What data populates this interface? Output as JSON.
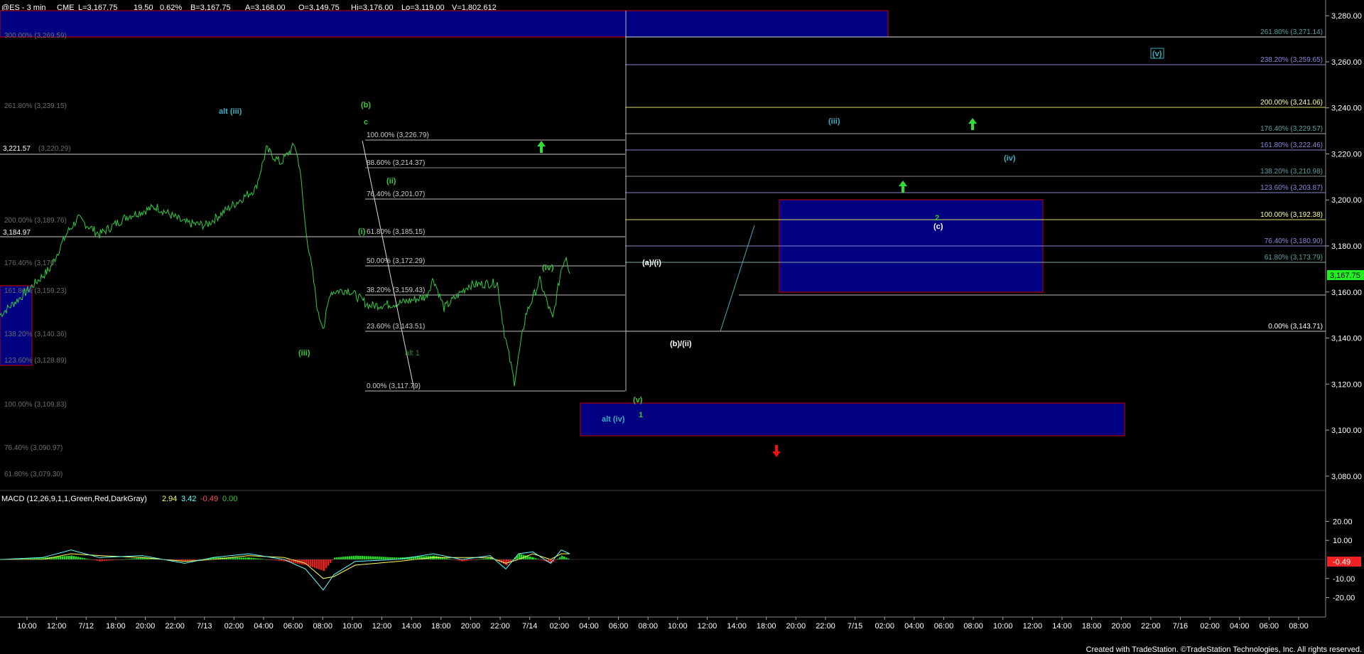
{
  "header": {
    "symbol": "@ES - 3 min",
    "exchange": "CME",
    "last": "L=3,167.75",
    "change": "19.50",
    "change_pct": "0.62%",
    "bid": "B=3,167.75",
    "ask": "A=3,168.00",
    "open": "O=3,149.75",
    "high": "Hi=3,176.00",
    "low": "Lo=3,119.00",
    "volume": "V=1,802,612"
  },
  "price_axis": {
    "ticks": [
      "3,280.00",
      "3,260.00",
      "3,240.00",
      "3,220.00",
      "3,200.00",
      "3,180.00",
      "3,160.00",
      "3,140.00",
      "3,120.00",
      "3,100.00",
      "3,080.00"
    ],
    "current_price": "3,167.75"
  },
  "time_axis": {
    "labels": [
      "10:00",
      "12:00",
      "7/12",
      "18:00",
      "20:00",
      "22:00",
      "7/13",
      "02:00",
      "04:00",
      "06:00",
      "08:00",
      "10:00",
      "12:00",
      "14:00",
      "18:00",
      "20:00",
      "22:00",
      "7/14",
      "02:00",
      "04:00",
      "06:00",
      "08:00",
      "10:00",
      "12:00",
      "14:00",
      "18:00",
      "20:00",
      "22:00",
      "7/15",
      "02:00",
      "04:00",
      "06:00",
      "08:00",
      "10:00",
      "12:00",
      "14:00",
      "18:00",
      "20:00",
      "22:00",
      "7/16",
      "02:00",
      "04:00",
      "06:00",
      "08:00"
    ]
  },
  "left_fib_labels": [
    "300.00% (3,269.59)",
    "261.80% (3,239.15)",
    "3,221.57",
    "(3,220.29)",
    "200.00% (3,189.76)",
    "3,184.97",
    "176.40% (3,170.",
    "161.80% (3,159.23)",
    "138.20% (3,140.36)",
    "123.60% (3,128.89)",
    "100.00% (3,109.83)",
    "76.40% (3,090.97)",
    "61.80% (3,079.30)"
  ],
  "middle_fib_labels": [
    "100.00% (3,226.79)",
    "88.60% (3,214.37)",
    "76.40% (3,201.07)",
    "61.80% (3,185.15)",
    "50.00% (3,172.29)",
    "38.20% (3,159.43)",
    "23.60% (3,143.51)",
    "0.00% (3,117.79)"
  ],
  "right_fib_labels": [
    "261.80% (3,271.14)",
    "238.20% (3,259.65)",
    "200.00% (3,241.06)",
    "176.40% (3,229.57)",
    "161.80% (3,222.46)",
    "138.20% (3,210.98)",
    "123.60% (3,203.87)",
    "100.00% (3,192.38)",
    "76.40% (3,180.90)",
    "61.80% (3,173.79)",
    "0.00% (3,143.71)"
  ],
  "wave_labels": [
    "alt (iii)",
    "(b)",
    "c",
    "(ii)",
    "(i)",
    "(iii)",
    "(iv)",
    "(a)/(i)",
    "(b)/(ii)",
    "(v)",
    "1",
    "alt (iv)",
    "(iii)",
    "(iv)",
    "2",
    "(c)",
    "(v)",
    "alt 1"
  ],
  "macd": {
    "title": "MACD (12,26,9,1,1,Green,Red,DarkGray)",
    "value1": "2.94",
    "value2": "3.42",
    "value3": "-0.49",
    "value4": "0.00",
    "ticks": [
      "20.00",
      "10.00",
      "-10.00",
      "-20.00"
    ],
    "current": "-0.49"
  },
  "footer": "Created with TradeStation. ©TradeStation Technologies, Inc. All rights reserved.",
  "chart_data": {
    "type": "line",
    "ylim": [
      3075,
      3285
    ],
    "macd_ylim": [
      -28,
      28
    ],
    "colors": {
      "background": "#000000",
      "price": "#2ecc40",
      "target_box": "#000080",
      "box_border": "#cc0000",
      "up_arrow": "#33dd33",
      "down_arrow": "#ee1111",
      "current_price_tag": "#22ee22",
      "macd_neg_tag": "#ee2222"
    },
    "price_path": [
      [
        0,
        3150
      ],
      [
        30,
        3158
      ],
      [
        70,
        3170
      ],
      [
        95,
        3186
      ],
      [
        110,
        3192
      ],
      [
        140,
        3185
      ],
      [
        180,
        3193
      ],
      [
        220,
        3197
      ],
      [
        260,
        3190
      ],
      [
        290,
        3189
      ],
      [
        320,
        3196
      ],
      [
        360,
        3205
      ],
      [
        375,
        3222
      ],
      [
        395,
        3216
      ],
      [
        415,
        3224
      ],
      [
        422,
        3214
      ],
      [
        430,
        3188
      ],
      [
        440,
        3168
      ],
      [
        448,
        3150
      ],
      [
        456,
        3145
      ],
      [
        465,
        3160
      ],
      [
        490,
        3161
      ],
      [
        520,
        3154
      ],
      [
        560,
        3155
      ],
      [
        600,
        3158
      ],
      [
        610,
        3166
      ],
      [
        625,
        3153
      ],
      [
        660,
        3163
      ],
      [
        700,
        3164
      ],
      [
        710,
        3142
      ],
      [
        724,
        3121
      ],
      [
        740,
        3150
      ],
      [
        760,
        3165
      ],
      [
        778,
        3148
      ],
      [
        790,
        3170
      ],
      [
        797,
        3176
      ],
      [
        802,
        3168
      ]
    ],
    "macd_line": [
      [
        0,
        0
      ],
      [
        60,
        1
      ],
      [
        100,
        5
      ],
      [
        140,
        1
      ],
      [
        200,
        2
      ],
      [
        260,
        -2
      ],
      [
        300,
        1
      ],
      [
        350,
        3
      ],
      [
        400,
        0
      ],
      [
        430,
        -5
      ],
      [
        455,
        -16
      ],
      [
        470,
        -8
      ],
      [
        500,
        -1
      ],
      [
        560,
        0
      ],
      [
        610,
        3
      ],
      [
        650,
        0
      ],
      [
        690,
        2
      ],
      [
        712,
        -5
      ],
      [
        730,
        3
      ],
      [
        750,
        4
      ],
      [
        775,
        -2
      ],
      [
        790,
        5
      ],
      [
        802,
        3
      ]
    ],
    "macd_signal": [
      [
        0,
        0
      ],
      [
        60,
        0
      ],
      [
        100,
        3
      ],
      [
        140,
        2
      ],
      [
        200,
        1
      ],
      [
        260,
        -1
      ],
      [
        300,
        0
      ],
      [
        350,
        2
      ],
      [
        400,
        1
      ],
      [
        430,
        -2
      ],
      [
        455,
        -10
      ],
      [
        470,
        -9
      ],
      [
        500,
        -3
      ],
      [
        560,
        -1
      ],
      [
        610,
        1
      ],
      [
        650,
        1
      ],
      [
        690,
        1
      ],
      [
        712,
        -2
      ],
      [
        730,
        0
      ],
      [
        750,
        3
      ],
      [
        775,
        0
      ],
      [
        790,
        3
      ],
      [
        802,
        3
      ]
    ],
    "macd_histogram": [
      [
        0,
        0
      ],
      [
        60,
        1
      ],
      [
        100,
        2
      ],
      [
        140,
        -1
      ],
      [
        200,
        1
      ],
      [
        260,
        -1
      ],
      [
        300,
        1
      ],
      [
        350,
        1
      ],
      [
        400,
        -1
      ],
      [
        430,
        -3
      ],
      [
        455,
        -6
      ],
      [
        470,
        1
      ],
      [
        500,
        2
      ],
      [
        560,
        1
      ],
      [
        610,
        2
      ],
      [
        650,
        -1
      ],
      [
        690,
        1
      ],
      [
        712,
        -3
      ],
      [
        730,
        3
      ],
      [
        750,
        1
      ],
      [
        775,
        -2
      ],
      [
        790,
        2
      ],
      [
        802,
        0
      ]
    ]
  }
}
